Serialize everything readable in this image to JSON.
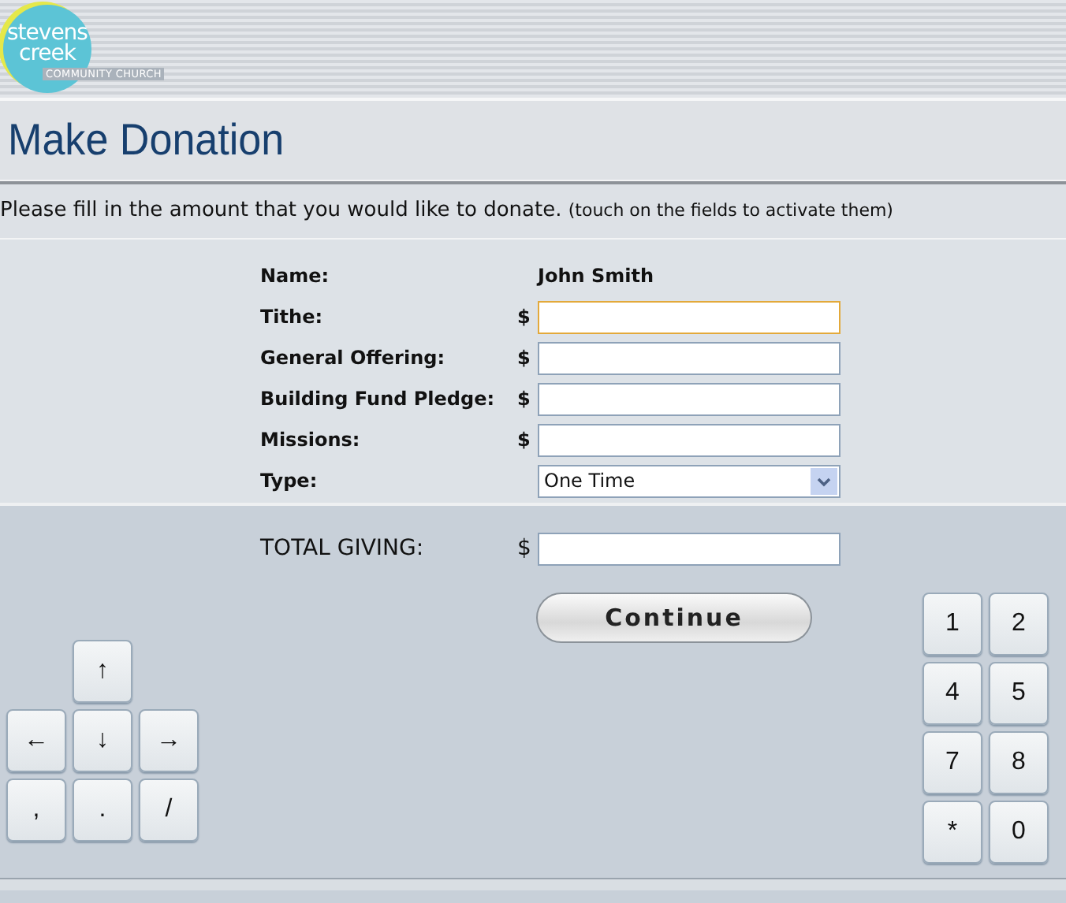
{
  "logo": {
    "name": [
      "stevens",
      "creek"
    ],
    "subtitle": "COMMUNITY CHURCH"
  },
  "title": "Make Donation",
  "instruction": {
    "text": "Please fill in the amount that you would like to donate.",
    "hint": "(touch on the fields to activate them)"
  },
  "form": {
    "name_label": "Name:",
    "name_value": "John Smith",
    "fields": [
      {
        "label": "Tithe:",
        "currency": "$",
        "focused": true
      },
      {
        "label": "General Offering:",
        "currency": "$",
        "focused": false
      },
      {
        "label": "Building Fund Pledge:",
        "currency": "$",
        "focused": false
      },
      {
        "label": "Missions:",
        "currency": "$",
        "focused": false
      }
    ],
    "type": {
      "label": "Type:",
      "value": "One Time"
    }
  },
  "total": {
    "label": "TOTAL GIVING:",
    "currency": "$"
  },
  "continue_button": "Continue",
  "arrow_keys": [
    [
      "↑"
    ],
    [
      "←",
      "↓",
      "→"
    ],
    [
      ",",
      ".",
      "/"
    ]
  ],
  "keypad": [
    [
      "1",
      "2"
    ],
    [
      "4",
      "5"
    ],
    [
      "7",
      "8"
    ],
    [
      "*",
      "0"
    ]
  ]
}
